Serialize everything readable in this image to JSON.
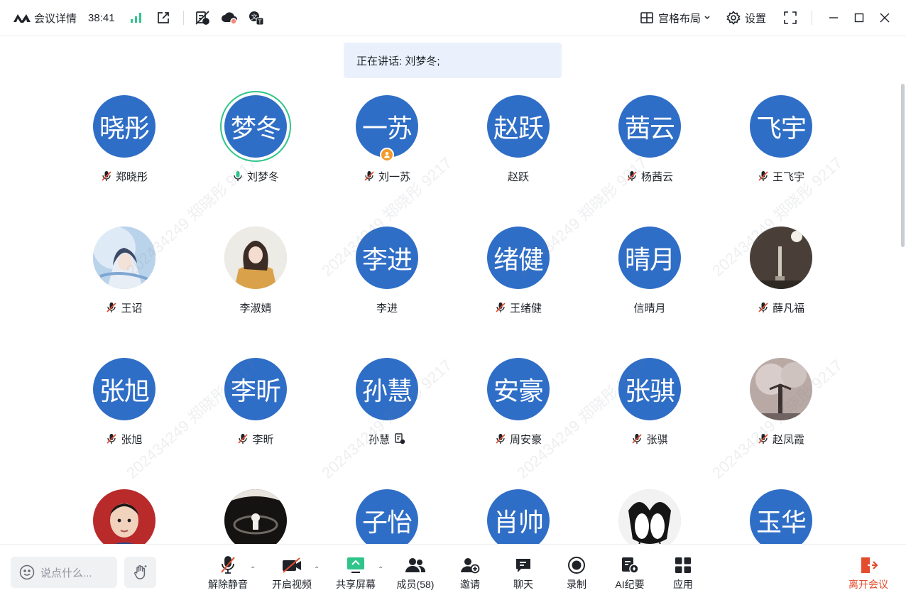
{
  "titlebar": {
    "title": "会议详情",
    "timer": "38:41",
    "layout_label": "宫格布局",
    "settings_label": "设置"
  },
  "speaking": "正在讲话: 刘梦冬;",
  "participants": [
    {
      "avatar_text": "晓彤",
      "name": "郑晓彤",
      "muted": true
    },
    {
      "avatar_text": "梦冬",
      "name": "刘梦冬",
      "muted": false,
      "speaking": true
    },
    {
      "avatar_text": "一苏",
      "name": "刘一苏",
      "muted": true,
      "host": true
    },
    {
      "avatar_text": "赵跃",
      "name": "赵跃",
      "muted": false
    },
    {
      "avatar_text": "茜云",
      "name": "杨茜云",
      "muted": true
    },
    {
      "avatar_text": "飞宇",
      "name": "王飞宇",
      "muted": true
    },
    {
      "avatar_text": "",
      "name": "王诏",
      "muted": true,
      "photo": "anime"
    },
    {
      "avatar_text": "",
      "name": "李淑婧",
      "muted": false,
      "photo": "girl"
    },
    {
      "avatar_text": "李进",
      "name": "李进",
      "muted": false
    },
    {
      "avatar_text": "绪健",
      "name": "王绪健",
      "muted": true
    },
    {
      "avatar_text": "晴月",
      "name": "信晴月",
      "muted": false
    },
    {
      "avatar_text": "",
      "name": "薛凡福",
      "muted": true,
      "photo": "night"
    },
    {
      "avatar_text": "张旭",
      "name": "张旭",
      "muted": true
    },
    {
      "avatar_text": "李昕",
      "name": "李昕",
      "muted": true
    },
    {
      "avatar_text": "孙慧",
      "name": "孙慧",
      "muted": false,
      "note": true
    },
    {
      "avatar_text": "安豪",
      "name": "周安豪",
      "muted": true
    },
    {
      "avatar_text": "张骐",
      "name": "张骐",
      "muted": true
    },
    {
      "avatar_text": "",
      "name": "赵凤霞",
      "muted": true,
      "photo": "sky"
    },
    {
      "avatar_text": "",
      "name": "",
      "photo": "boy"
    },
    {
      "avatar_text": "",
      "name": "",
      "photo": "astro"
    },
    {
      "avatar_text": "子怡",
      "name": ""
    },
    {
      "avatar_text": "肖帅",
      "name": ""
    },
    {
      "avatar_text": "",
      "name": "",
      "photo": "penguin"
    },
    {
      "avatar_text": "玉华",
      "name": ""
    }
  ],
  "watermark": "20243424​9 郑晓彤 9217",
  "toolbar": {
    "chat_placeholder": "说点什么...",
    "unmute": "解除静音",
    "video": "开启视频",
    "share": "共享屏幕",
    "members": "成员(58)",
    "invite": "邀请",
    "chat": "聊天",
    "record": "录制",
    "ai_notes": "AI纪要",
    "apps": "应用",
    "leave": "离开会议"
  },
  "colors": {
    "avatar_blue": "#2f6ec6",
    "speaking_ring": "#2fc58a",
    "leave_red": "#e34d2d",
    "signal_green": "#2fc58a"
  }
}
